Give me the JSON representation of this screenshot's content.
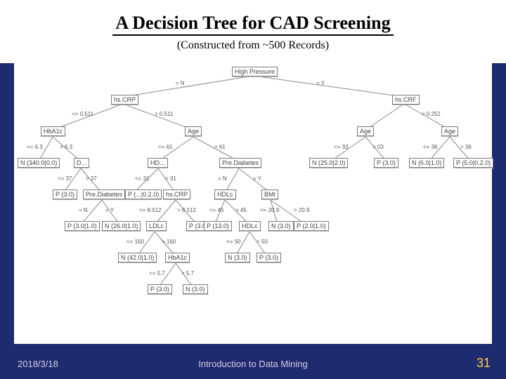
{
  "title": "A Decision Tree for CAD Screening",
  "subtitle": "(Constructed from ~500  Records)",
  "footer": {
    "date": "2018/3/18",
    "mid": "Introduction to Data Mining",
    "num": "31"
  },
  "nodes": {
    "root": "High Pressure",
    "hscrp_l": "hs.CRP",
    "hscrp_r": "hs.CRF",
    "hba1c": "HbA1c",
    "age1": "Age",
    "age2": "Age",
    "age3": "Age",
    "leaf_N340": "N (340.0|0.0)",
    "d1": "D...",
    "hdl1": "HD...",
    "prediab1": "Pre.Diabetes",
    "leaf_N25": "N (25.0|2.0)",
    "leaf_P30a": "P (3.0)",
    "leaf_N6": "N (6.0|1.0)",
    "leaf_P50": "P (5.0|0.2.0)",
    "leaf_P3c": "P (3.0)",
    "prediab2": "Pre.Diabetes",
    "leaf_P3d": "P (...|0.2.0)",
    "hscrp2": "hs.CRP",
    "hdlc1": "HDLc",
    "bmi": "BMI",
    "leaf_P30u": "P (3.0|1.0)",
    "leaf_N26": "N (26.0|1.0)",
    "ldlc": "LDLc",
    "leaf_P3e": "P (3.0)",
    "leaf_P13": "P (13.0)",
    "hdlc2": "HDLc",
    "leaf_N3": "N (3.0)",
    "leaf_P2": "P (2.0|1.0)",
    "leaf_N42": "N (42.0|1.0)",
    "hba1c2": "HbA1c",
    "leaf_N30": "N (3.0)",
    "leaf_P30f": "P (3.0)",
    "leaf_P30g": "P (3.0)",
    "leaf_N30b": "N (3.0)"
  },
  "labels": {
    "eN": "= N",
    "eY": "= Y",
    "le0511": "<= 0.511",
    "gt0511": "> 0.511",
    "gt0251": "> 0.251",
    "le63": "<= 6.3",
    "gt63": "> 6.3",
    "le61": "<= 61",
    "gt61": "> 61",
    "le33": "<= 33",
    "gt03": "> 03",
    "le36": "<= 36",
    "gt36": "> 36",
    "le37": "<= 37",
    "gt37": "> 37",
    "le31": "<= 31",
    "gt31": "> 31",
    "eN2": "= N",
    "eY2": "= Y",
    "eN3": "= N",
    "eY3": "= Y",
    "le8512": "<= 8.512",
    "gt8512": "> 8.512",
    "le45": "<= 45",
    "gt45": "> 45",
    "le209": "<= 20.9",
    "gt209": "> 20.9",
    "le160": "<= 160",
    "gt160": "> 160",
    "le50": "<= 50",
    "gt50": "> 50",
    "le57": "<= 5.7",
    "gt57": "> 5.7"
  }
}
